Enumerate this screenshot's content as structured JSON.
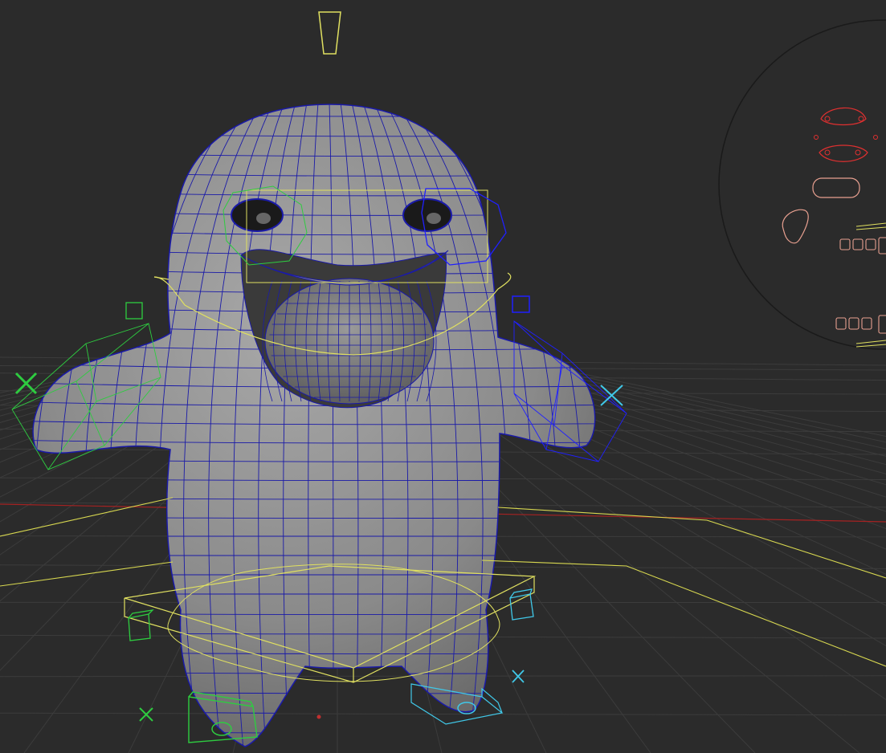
{
  "viewport": {
    "kind": "3d-viewport",
    "background_color": "#2b2b2b",
    "grid_color": "#3c3c3c",
    "axis_x_color": "#b02020",
    "mesh_fill_color": "#8c8c8c",
    "wireframe_color": "#1a1aa8"
  },
  "rig_controls": {
    "selection_color": "#e0e060",
    "left_side_color": "#2ecc40",
    "right_side_color": "#2020ff",
    "right_foot_color": "#40c8e8",
    "face_picker_color": "#e03030",
    "face_picker_secondary_color": "#e8a090"
  },
  "character": {
    "name_icon": "creature-mesh"
  }
}
